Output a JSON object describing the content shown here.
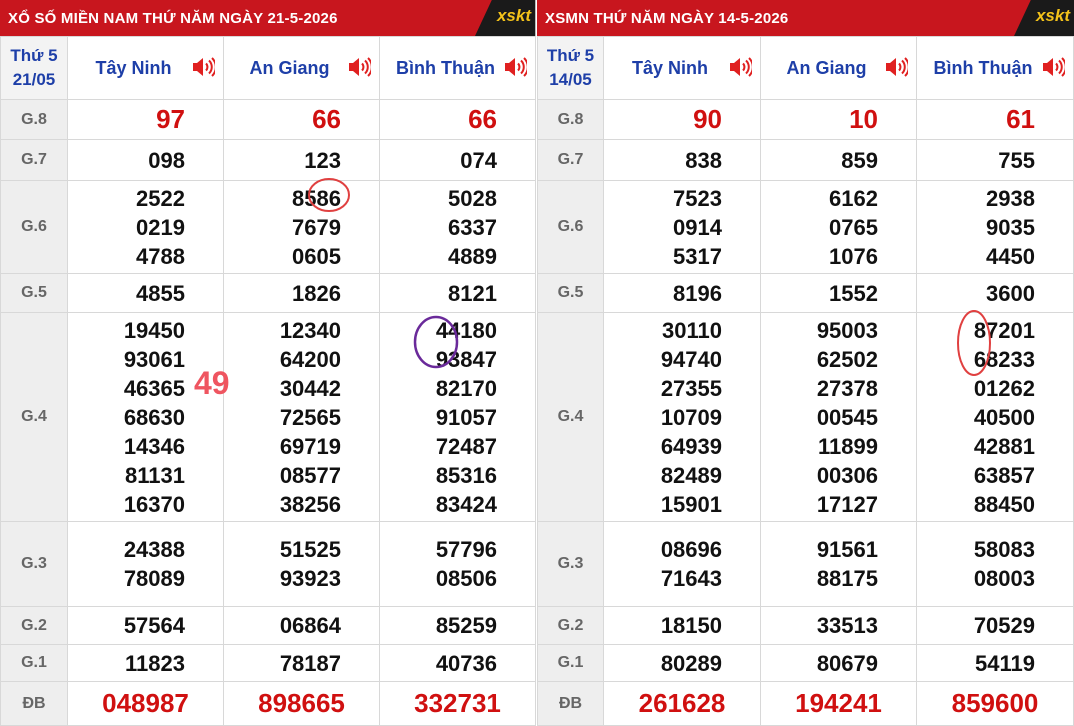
{
  "left": {
    "title": "XỔ SỐ MIỀN NAM THỨ NĂM NGÀY 21-5-2026",
    "logo": "xskt",
    "date_day": "Thứ 5",
    "date_short": "21/05",
    "provinces": [
      "Tây Ninh",
      "An Giang",
      "Bình Thuận"
    ],
    "prizes": {
      "g8": [
        "97",
        "66",
        "66"
      ],
      "g7": [
        "098",
        "123",
        "074"
      ],
      "g6": [
        [
          "2522",
          "0219",
          "4788"
        ],
        [
          "8586",
          "7679",
          "0605"
        ],
        [
          "5028",
          "6337",
          "4889"
        ]
      ],
      "g5": [
        "4855",
        "1826",
        "8121"
      ],
      "g4": [
        [
          "19450",
          "93061",
          "46365",
          "68630",
          "14346",
          "81131",
          "16370"
        ],
        [
          "12340",
          "64200",
          "30442",
          "72565",
          "69719",
          "08577",
          "38256"
        ],
        [
          "44180",
          "93847",
          "82170",
          "91057",
          "72487",
          "85316",
          "83424"
        ]
      ],
      "g3": [
        [
          "24388",
          "78089"
        ],
        [
          "51525",
          "93923"
        ],
        [
          "57796",
          "08506"
        ]
      ],
      "g2": [
        "57564",
        "06864",
        "85259"
      ],
      "g1": [
        "11823",
        "78187",
        "40736"
      ],
      "db": [
        "048987",
        "898665",
        "332731"
      ]
    },
    "annotation": "49"
  },
  "right": {
    "title": "XSMN THỨ NĂM NGÀY 14-5-2026",
    "logo": "xskt",
    "date_day": "Thứ 5",
    "date_short": "14/05",
    "provinces": [
      "Tây Ninh",
      "An Giang",
      "Bình Thuận"
    ],
    "prizes": {
      "g8": [
        "90",
        "10",
        "61"
      ],
      "g7": [
        "838",
        "859",
        "755"
      ],
      "g6": [
        [
          "7523",
          "0914",
          "5317"
        ],
        [
          "6162",
          "0765",
          "1076"
        ],
        [
          "2938",
          "9035",
          "4450"
        ]
      ],
      "g5": [
        "8196",
        "1552",
        "3600"
      ],
      "g4": [
        [
          "30110",
          "94740",
          "27355",
          "10709",
          "64939",
          "82489",
          "15901"
        ],
        [
          "95003",
          "62502",
          "27378",
          "00545",
          "11899",
          "00306",
          "17127"
        ],
        [
          "87201",
          "68233",
          "01262",
          "40500",
          "42881",
          "63857",
          "88450"
        ]
      ],
      "g3": [
        [
          "08696",
          "71643"
        ],
        [
          "91561",
          "88175"
        ],
        [
          "58083",
          "08003"
        ]
      ],
      "g2": [
        "18150",
        "33513",
        "70529"
      ],
      "g1": [
        "80289",
        "80679",
        "54119"
      ],
      "db": [
        "261628",
        "194241",
        "859600"
      ]
    }
  },
  "labels": {
    "g8": "G.8",
    "g7": "G.7",
    "g6": "G.6",
    "g5": "G.5",
    "g4": "G.4",
    "g3": "G.3",
    "g2": "G.2",
    "g1": "G.1",
    "db": "ĐB"
  },
  "colors": {
    "header_red": "#c8161e",
    "province_blue": "#1e3fa8",
    "prize_red": "#d01010",
    "label_gray": "#666666"
  },
  "icons": {
    "speaker": "speaker-icon"
  }
}
